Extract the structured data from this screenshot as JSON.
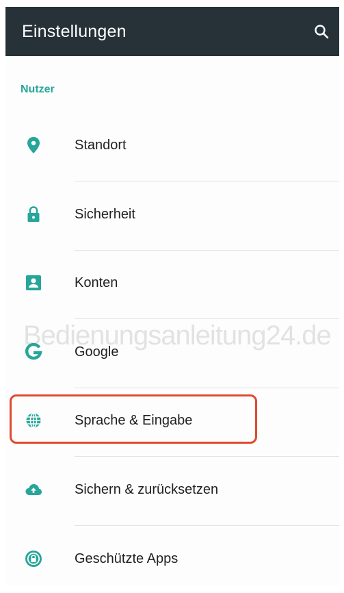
{
  "header": {
    "title": "Einstellungen",
    "search_icon": "search-icon"
  },
  "section": {
    "title": "Nutzer"
  },
  "items": [
    {
      "label": "Standort",
      "icon": "location-pin-icon"
    },
    {
      "label": "Sicherheit",
      "icon": "lock-icon"
    },
    {
      "label": "Konten",
      "icon": "account-box-icon"
    },
    {
      "label": "Google",
      "icon": "google-g-icon"
    },
    {
      "label": "Sprache & Eingabe",
      "icon": "globe-icon"
    },
    {
      "label": "Sichern & zurücksetzen",
      "icon": "cloud-upload-icon"
    },
    {
      "label": "Geschützte Apps",
      "icon": "protected-apps-icon"
    }
  ],
  "watermark": "Bedienungsanleitung24.de",
  "colors": {
    "appbar": "#263238",
    "accent": "#26a69a",
    "highlight": "#e0492f"
  }
}
